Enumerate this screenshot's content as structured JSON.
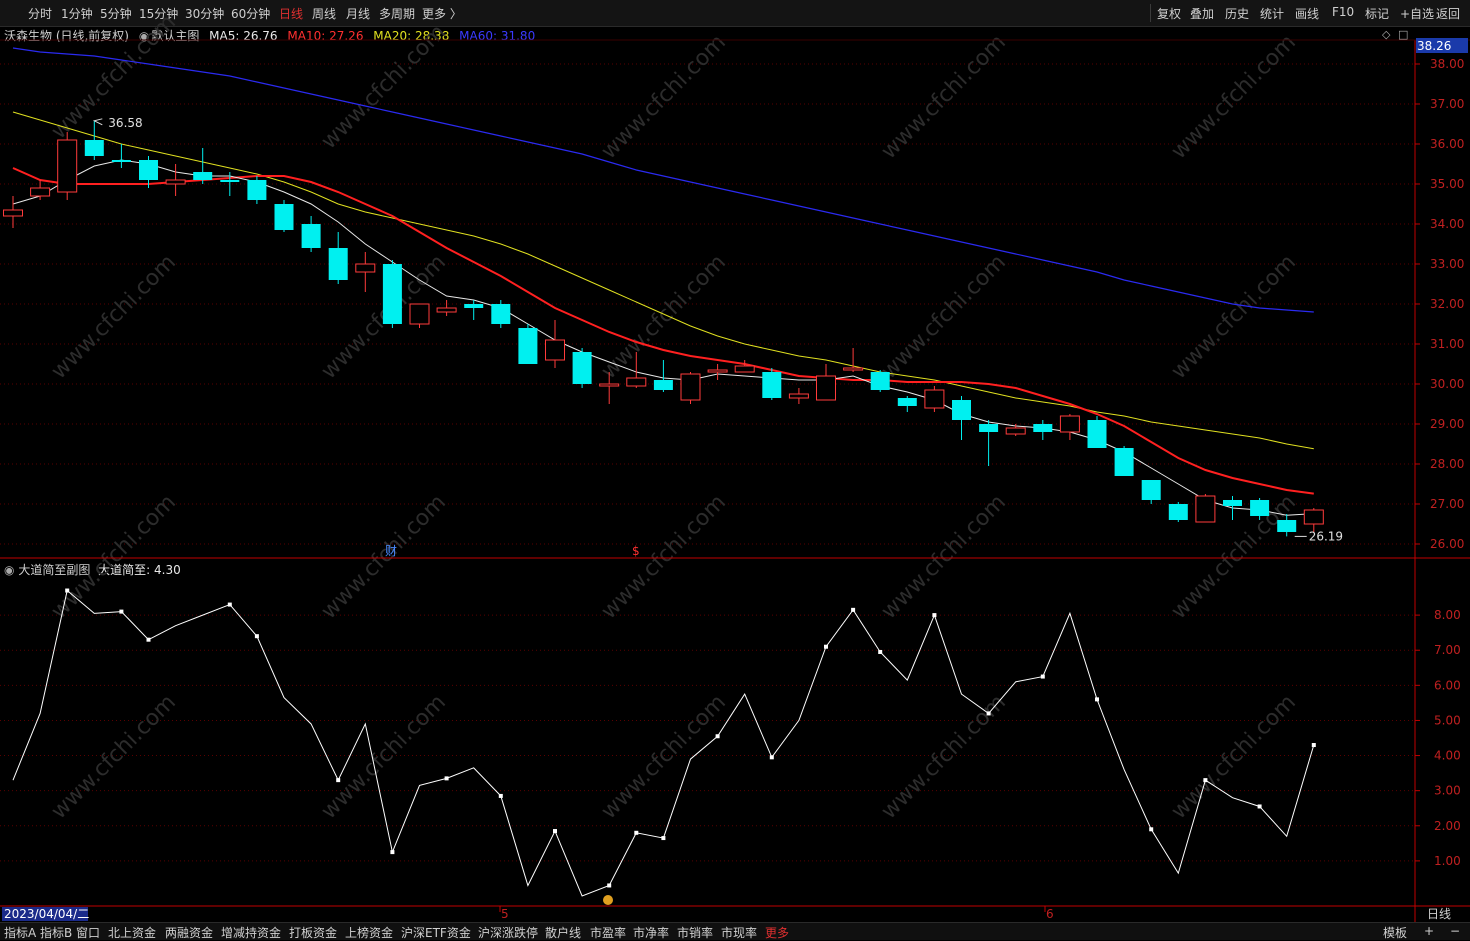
{
  "toolbar": {
    "periods": [
      "分时",
      "1分钟",
      "5分钟",
      "15分钟",
      "30分钟",
      "60分钟",
      "日线",
      "周线",
      "月线",
      "多周期",
      "更多 〉"
    ],
    "active_period": "日线",
    "right_tools": [
      "复权",
      "叠加",
      "历史",
      "统计",
      "画线",
      "F10",
      "标记",
      "+自选",
      "返回"
    ]
  },
  "main_legend": {
    "stock": "沃森生物 (日线,前复权)",
    "indicator": "默认主图",
    "ma5": "MA5: 26.76",
    "ma10": "MA10: 27.26",
    "ma20": "MA20: 28.38",
    "ma60": "MA60: 31.80"
  },
  "colors": {
    "ma5": "#e8e8e8",
    "ma10": "#ff2020",
    "ma20": "#e0e020",
    "ma60": "#2a2af0",
    "up": "#ff3b3b",
    "down": "#00f0f0",
    "axis": "#c00000"
  },
  "price_axis": {
    "ticks": [
      "38.00",
      "37.00",
      "36.00",
      "35.00",
      "34.00",
      "33.00",
      "32.00",
      "31.00",
      "30.00",
      "29.00",
      "28.00",
      "27.00",
      "26.00"
    ],
    "current": "38.26",
    "high_label": "36.58",
    "low_label": "26.19",
    "event_cai": "财",
    "event_dollar": "$"
  },
  "sub_legend": {
    "name": "大道简至副图",
    "value": "大道简至: 4.30"
  },
  "sub_axis": {
    "ticks": [
      "8.00",
      "7.00",
      "6.00",
      "5.00",
      "4.00",
      "3.00",
      "2.00",
      "1.00"
    ]
  },
  "time_axis": {
    "date": "2023/04/04/二",
    "month5": "5",
    "month6": "6",
    "period": "日线"
  },
  "bottom_tabs": [
    "指标A",
    "指标B",
    "窗口",
    "北上资金",
    "两融资金",
    "增减持资金",
    "打板资金",
    "上榜资金",
    "沪深ETF资金",
    "沪深涨跌停",
    "散户线",
    "市盈率",
    "市净率",
    "市销率",
    "市现率",
    "更多"
  ],
  "bottom_right": [
    "模板",
    "+",
    "−"
  ],
  "watermark": "www.cfchi.com",
  "chart_data": {
    "type": "candlestick",
    "ylim": [
      25.7,
      38.5
    ],
    "candles": [
      {
        "o": 34.2,
        "c": 34.35,
        "h": 34.7,
        "l": 33.9
      },
      {
        "o": 34.7,
        "c": 34.9,
        "h": 35.1,
        "l": 34.6
      },
      {
        "o": 34.8,
        "c": 36.1,
        "h": 36.3,
        "l": 34.6
      },
      {
        "o": 36.1,
        "c": 35.7,
        "h": 36.58,
        "l": 35.6
      },
      {
        "o": 35.6,
        "c": 35.55,
        "h": 36.0,
        "l": 35.4
      },
      {
        "o": 35.6,
        "c": 35.1,
        "h": 35.7,
        "l": 34.9
      },
      {
        "o": 35.0,
        "c": 35.1,
        "h": 35.5,
        "l": 34.7
      },
      {
        "o": 35.3,
        "c": 35.1,
        "h": 35.9,
        "l": 35.0
      },
      {
        "o": 35.1,
        "c": 35.05,
        "h": 35.3,
        "l": 34.7
      },
      {
        "o": 35.1,
        "c": 34.6,
        "h": 35.2,
        "l": 34.5
      },
      {
        "o": 34.5,
        "c": 33.85,
        "h": 34.6,
        "l": 33.8
      },
      {
        "o": 34.0,
        "c": 33.4,
        "h": 34.2,
        "l": 33.3
      },
      {
        "o": 33.4,
        "c": 32.6,
        "h": 33.8,
        "l": 32.5
      },
      {
        "o": 32.8,
        "c": 33.0,
        "h": 33.3,
        "l": 32.3
      },
      {
        "o": 33.0,
        "c": 31.5,
        "h": 33.1,
        "l": 31.4
      },
      {
        "o": 31.5,
        "c": 32.0,
        "h": 32.0,
        "l": 31.4
      },
      {
        "o": 31.8,
        "c": 31.9,
        "h": 32.1,
        "l": 31.7
      },
      {
        "o": 32.0,
        "c": 31.9,
        "h": 32.1,
        "l": 31.6
      },
      {
        "o": 32.0,
        "c": 31.5,
        "h": 32.1,
        "l": 31.4
      },
      {
        "o": 31.4,
        "c": 30.5,
        "h": 31.5,
        "l": 30.5
      },
      {
        "o": 30.6,
        "c": 31.1,
        "h": 31.6,
        "l": 30.4
      },
      {
        "o": 30.8,
        "c": 30.0,
        "h": 30.9,
        "l": 29.9
      },
      {
        "o": 29.95,
        "c": 30.0,
        "h": 30.3,
        "l": 29.5
      },
      {
        "o": 29.95,
        "c": 30.15,
        "h": 30.8,
        "l": 29.9
      },
      {
        "o": 30.1,
        "c": 29.85,
        "h": 30.6,
        "l": 29.8
      },
      {
        "o": 29.6,
        "c": 30.25,
        "h": 30.3,
        "l": 29.5
      },
      {
        "o": 30.3,
        "c": 30.35,
        "h": 30.5,
        "l": 30.1
      },
      {
        "o": 30.3,
        "c": 30.45,
        "h": 30.6,
        "l": 30.3
      },
      {
        "o": 30.3,
        "c": 29.65,
        "h": 30.4,
        "l": 29.6
      },
      {
        "o": 29.65,
        "c": 29.75,
        "h": 29.9,
        "l": 29.5
      },
      {
        "o": 29.6,
        "c": 30.2,
        "h": 30.5,
        "l": 29.6
      },
      {
        "o": 30.35,
        "c": 30.4,
        "h": 30.9,
        "l": 30.3
      },
      {
        "o": 30.3,
        "c": 29.85,
        "h": 30.35,
        "l": 29.8
      },
      {
        "o": 29.65,
        "c": 29.45,
        "h": 29.7,
        "l": 29.3
      },
      {
        "o": 29.4,
        "c": 29.85,
        "h": 29.95,
        "l": 29.3
      },
      {
        "o": 29.6,
        "c": 29.1,
        "h": 29.7,
        "l": 28.6
      },
      {
        "o": 29.0,
        "c": 28.8,
        "h": 29.1,
        "l": 27.95
      },
      {
        "o": 28.75,
        "c": 28.9,
        "h": 29.0,
        "l": 28.7
      },
      {
        "o": 29.0,
        "c": 28.8,
        "h": 29.1,
        "l": 28.6
      },
      {
        "o": 28.8,
        "c": 29.2,
        "h": 29.25,
        "l": 28.6
      },
      {
        "o": 29.1,
        "c": 28.4,
        "h": 29.2,
        "l": 28.4
      },
      {
        "o": 28.4,
        "c": 27.7,
        "h": 28.45,
        "l": 27.7
      },
      {
        "o": 27.6,
        "c": 27.1,
        "h": 27.6,
        "l": 27.0
      },
      {
        "o": 27.0,
        "c": 26.6,
        "h": 27.05,
        "l": 26.55
      },
      {
        "o": 26.55,
        "c": 27.2,
        "h": 27.25,
        "l": 26.55
      },
      {
        "o": 27.1,
        "c": 26.95,
        "h": 27.2,
        "l": 26.6
      },
      {
        "o": 27.1,
        "c": 26.7,
        "h": 27.15,
        "l": 26.6
      },
      {
        "o": 26.6,
        "c": 26.3,
        "h": 26.75,
        "l": 26.19
      },
      {
        "o": 26.5,
        "c": 26.85,
        "h": 26.9,
        "l": 26.3
      }
    ],
    "ma5": [
      34.5,
      34.7,
      35.1,
      35.45,
      35.6,
      35.5,
      35.3,
      35.2,
      35.2,
      35.05,
      34.8,
      34.5,
      34.05,
      33.5,
      33.05,
      32.6,
      32.2,
      32.1,
      31.9,
      31.5,
      31.1,
      30.8,
      30.55,
      30.3,
      30.15,
      30.1,
      30.25,
      30.2,
      30.15,
      30.1,
      30.1,
      30.2,
      29.95,
      29.8,
      29.6,
      29.25,
      29.05,
      28.95,
      28.9,
      28.8,
      28.6,
      28.3,
      27.9,
      27.5,
      27.1,
      26.9,
      26.85,
      26.72,
      26.76
    ],
    "ma10": [
      35.4,
      35.1,
      35.0,
      35.0,
      35.0,
      35.0,
      35.05,
      35.1,
      35.15,
      35.2,
      35.2,
      35.05,
      34.8,
      34.5,
      34.2,
      33.8,
      33.4,
      33.05,
      32.7,
      32.3,
      31.9,
      31.6,
      31.3,
      31.05,
      30.85,
      30.7,
      30.6,
      30.5,
      30.35,
      30.2,
      30.15,
      30.1,
      30.1,
      30.05,
      30.05,
      30.05,
      30.0,
      29.9,
      29.7,
      29.5,
      29.25,
      28.95,
      28.55,
      28.15,
      27.85,
      27.65,
      27.5,
      27.35,
      27.26
    ],
    "ma20": [
      36.8,
      36.6,
      36.4,
      36.2,
      36.0,
      35.85,
      35.7,
      35.55,
      35.4,
      35.25,
      35.05,
      34.8,
      34.5,
      34.3,
      34.15,
      34.0,
      33.85,
      33.7,
      33.5,
      33.25,
      32.95,
      32.65,
      32.35,
      32.05,
      31.75,
      31.45,
      31.2,
      31.0,
      30.85,
      30.7,
      30.6,
      30.45,
      30.3,
      30.2,
      30.1,
      29.95,
      29.8,
      29.65,
      29.55,
      29.45,
      29.3,
      29.2,
      29.05,
      28.95,
      28.85,
      28.75,
      28.65,
      28.5,
      28.38
    ],
    "ma60": [
      38.4,
      38.3,
      38.25,
      38.2,
      38.1,
      38.0,
      37.9,
      37.8,
      37.7,
      37.55,
      37.4,
      37.25,
      37.1,
      36.95,
      36.8,
      36.65,
      36.5,
      36.35,
      36.2,
      36.05,
      35.9,
      35.75,
      35.55,
      35.35,
      35.2,
      35.05,
      34.9,
      34.75,
      34.6,
      34.45,
      34.3,
      34.15,
      34.0,
      33.85,
      33.7,
      33.55,
      33.4,
      33.25,
      33.1,
      32.95,
      32.8,
      32.6,
      32.45,
      32.3,
      32.15,
      32.0,
      31.9,
      31.85,
      31.8
    ],
    "sub_ylim": [
      0,
      9
    ],
    "sub_values": [
      3.3,
      5.2,
      8.7,
      8.05,
      8.1,
      7.3,
      7.7,
      8.0,
      8.3,
      7.4,
      5.65,
      4.9,
      3.3,
      4.9,
      1.25,
      3.15,
      3.35,
      3.65,
      2.85,
      0.3,
      1.85,
      0.0,
      0.3,
      1.8,
      1.65,
      3.9,
      4.55,
      5.75,
      3.95,
      5.0,
      7.1,
      8.15,
      6.95,
      6.15,
      8.0,
      5.75,
      5.2,
      6.1,
      6.25,
      8.05,
      5.6,
      3.6,
      1.9,
      0.65,
      3.3,
      2.8,
      2.55,
      1.7,
      4.3
    ]
  }
}
